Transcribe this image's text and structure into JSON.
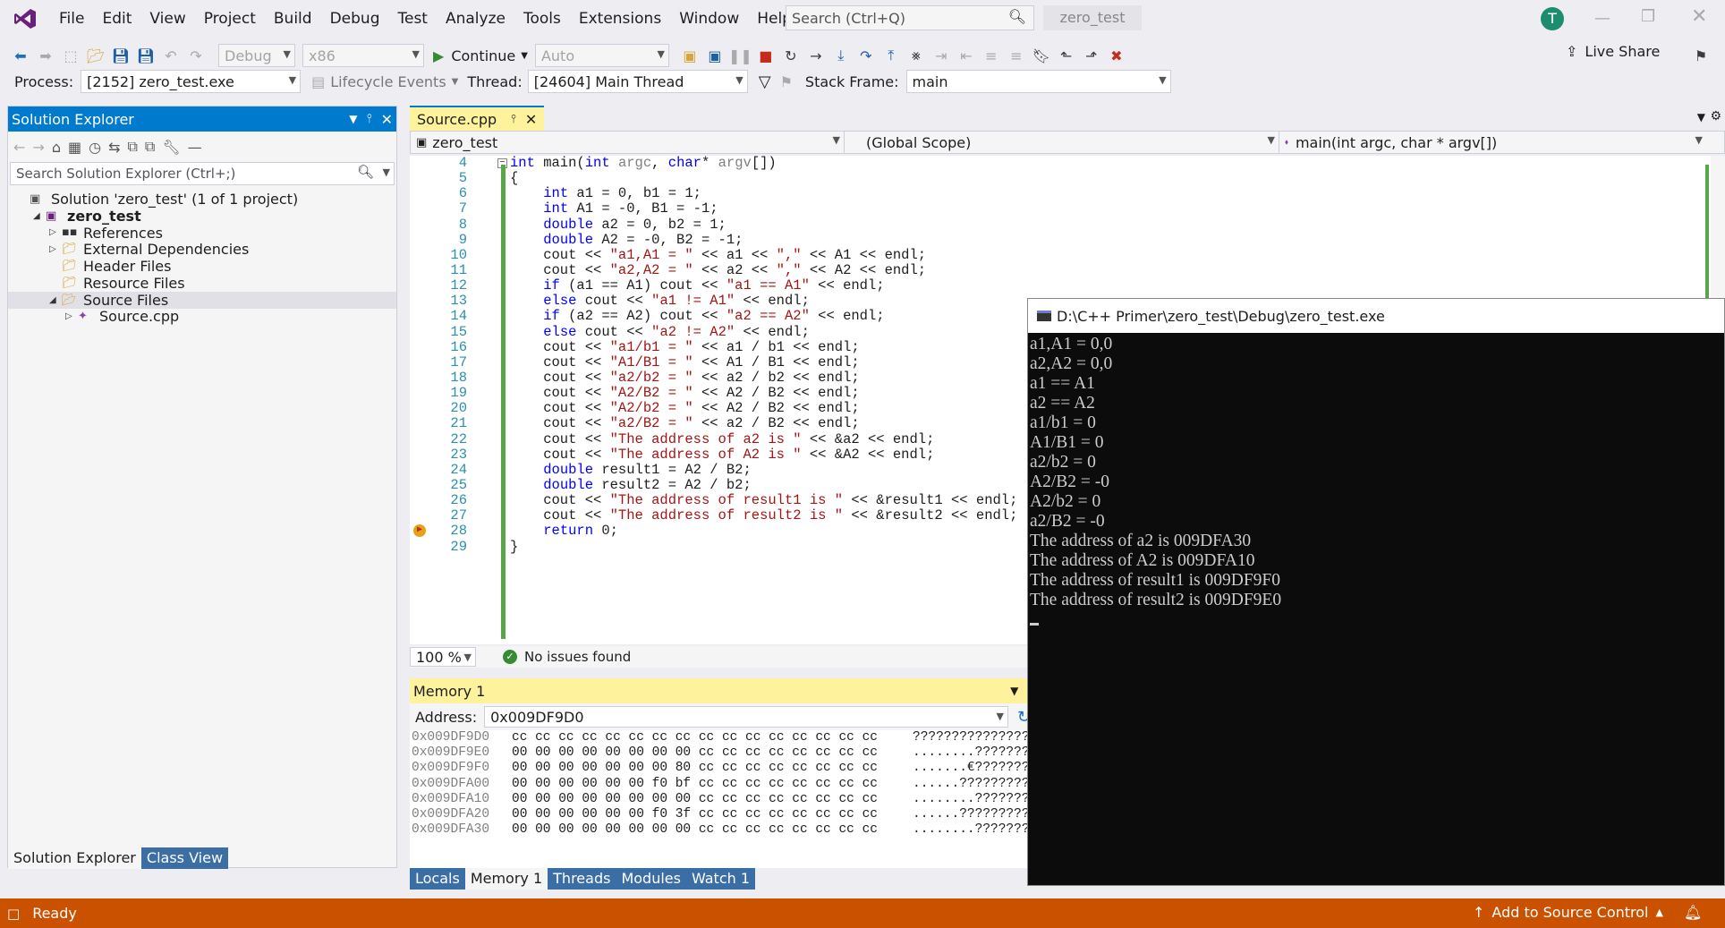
{
  "menu": {
    "items": [
      "File",
      "Edit",
      "View",
      "Project",
      "Build",
      "Debug",
      "Test",
      "Analyze",
      "Tools",
      "Extensions",
      "Window",
      "Help"
    ],
    "search_placeholder": "Search (Ctrl+Q)",
    "solution_name": "zero_test",
    "avatar": "T"
  },
  "toolbar": {
    "config": "Debug",
    "platform": "x86",
    "continue": "Continue",
    "auto": "Auto",
    "live_share": "Live Share"
  },
  "debugbar": {
    "process_label": "Process:",
    "process": "[2152] zero_test.exe",
    "lifecycle": "Lifecycle Events",
    "thread_label": "Thread:",
    "thread": "[24604] Main Thread",
    "stack_label": "Stack Frame:",
    "stack": "main"
  },
  "solution_explorer": {
    "title": "Solution Explorer",
    "search_placeholder": "Search Solution Explorer (Ctrl+;)",
    "items": [
      "Solution 'zero_test' (1 of 1 project)",
      "zero_test",
      "References",
      "External Dependencies",
      "Header Files",
      "Resource Files",
      "Source Files",
      "Source.cpp"
    ],
    "tabs": [
      "Solution Explorer",
      "Class View"
    ]
  },
  "editor": {
    "tab": "Source.cpp",
    "nav_project": "zero_test",
    "nav_scope": "(Global Scope)",
    "nav_func": "main(int argc, char * argv[])",
    "zoom": "100 %",
    "issues": "No issues found",
    "lines": [
      {
        "n": "4",
        "t": "int main(int argc, char* argv[])"
      },
      {
        "n": "5",
        "t": "{"
      },
      {
        "n": "6",
        "t": "    int a1 = 0, b1 = 1;"
      },
      {
        "n": "7",
        "t": "    int A1 = -0, B1 = -1;"
      },
      {
        "n": "8",
        "t": "    double a2 = 0, b2 = 1;"
      },
      {
        "n": "9",
        "t": "    double A2 = -0, B2 = -1;"
      },
      {
        "n": "10",
        "t": "    cout << \"a1,A1 = \" << a1 << \",\" << A1 << endl;"
      },
      {
        "n": "11",
        "t": "    cout << \"a2,A2 = \" << a2 << \",\" << A2 << endl;"
      },
      {
        "n": "12",
        "t": "    if (a1 == A1) cout << \"a1 == A1\" << endl;"
      },
      {
        "n": "13",
        "t": "    else cout << \"a1 != A1\" << endl;"
      },
      {
        "n": "14",
        "t": "    if (a2 == A2) cout << \"a2 == A2\" << endl;"
      },
      {
        "n": "15",
        "t": "    else cout << \"a2 != A2\" << endl;"
      },
      {
        "n": "16",
        "t": "    cout << \"a1/b1 = \" << a1 / b1 << endl;"
      },
      {
        "n": "17",
        "t": "    cout << \"A1/B1 = \" << A1 / B1 << endl;"
      },
      {
        "n": "18",
        "t": "    cout << \"a2/b2 = \" << a2 / b2 << endl;"
      },
      {
        "n": "19",
        "t": "    cout << \"A2/B2 = \" << A2 / B2 << endl;"
      },
      {
        "n": "20",
        "t": "    cout << \"A2/b2 = \" << A2 / B2 << endl;"
      },
      {
        "n": "21",
        "t": "    cout << \"a2/B2 = \" << a2 / B2 << endl;"
      },
      {
        "n": "22",
        "t": "    cout << \"The address of a2 is \" << &a2 << endl;"
      },
      {
        "n": "23",
        "t": "    cout << \"The address of A2 is \" << &A2 << endl;"
      },
      {
        "n": "24",
        "t": "    double result1 = A2 / B2;"
      },
      {
        "n": "25",
        "t": "    double result2 = A2 / b2;"
      },
      {
        "n": "26",
        "t": "    cout << \"The address of result1 is \" << &result1 << endl;"
      },
      {
        "n": "27",
        "t": "    cout << \"The address of result2 is \" << &result2 << endl;"
      },
      {
        "n": "28",
        "t": "    return 0;"
      },
      {
        "n": "29",
        "t": "}"
      }
    ]
  },
  "memory": {
    "title": "Memory 1",
    "address_label": "Address:",
    "address": "0x009DF9D0",
    "rows": [
      {
        "a": "0x009DF9D0",
        "h": "cc cc cc cc cc cc cc cc cc cc cc cc cc cc cc cc",
        "s": "????????????????"
      },
      {
        "a": "0x009DF9E0",
        "h": "00 00 00 00 00 00 00 00 cc cc cc cc cc cc cc cc",
        "s": "........????????"
      },
      {
        "a": "0x009DF9F0",
        "h": "00 00 00 00 00 00 00 80 cc cc cc cc cc cc cc cc",
        "s": ".......€????????"
      },
      {
        "a": "0x009DFA00",
        "h": "00 00 00 00 00 00 f0 bf cc cc cc cc cc cc cc cc",
        "s": "......??????????"
      },
      {
        "a": "0x009DFA10",
        "h": "00 00 00 00 00 00 00 00 cc cc cc cc cc cc cc cc",
        "s": "........????????"
      },
      {
        "a": "0x009DFA20",
        "h": "00 00 00 00 00 00 f0 3f cc cc cc cc cc cc cc cc",
        "s": "......??????????"
      },
      {
        "a": "0x009DFA30",
        "h": "00 00 00 00 00 00 00 00 cc cc cc cc cc cc cc cc",
        "s": "........????????"
      }
    ],
    "tabs": [
      "Locals",
      "Memory 1",
      "Threads",
      "Modules",
      "Watch 1"
    ]
  },
  "console": {
    "title": "D:\\C++ Primer\\zero_test\\Debug\\zero_test.exe",
    "lines": [
      "a1,A1 = 0,0",
      "a2,A2 = 0,0",
      "a1 == A1",
      "a2 == A2",
      "a1/b1 = 0",
      "A1/B1 = 0",
      "a2/b2 = 0",
      "A2/B2 = -0",
      "A2/b2 = 0",
      "a2/B2 = -0",
      "The address of a2 is 009DFA30",
      "The address of A2 is 009DFA10",
      "The address of result1 is 009DF9F0",
      "The address of result2 is 009DF9E0"
    ]
  },
  "status": {
    "ready": "Ready",
    "source_control": "Add to Source Control"
  },
  "colors": {
    "accent": "#007acc",
    "status": "#ca5100",
    "debug_bar": "#ca5100",
    "tab_active": "#fff29d"
  }
}
